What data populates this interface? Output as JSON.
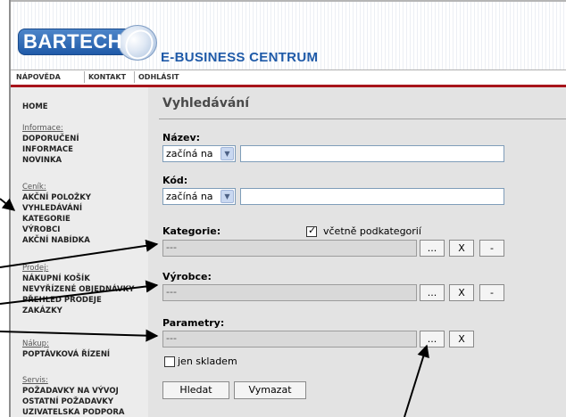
{
  "header": {
    "logo_text": "BARTECH",
    "title": "E-BUSINESS CENTRUM"
  },
  "topnav": {
    "items": [
      "NÁPOVĚDA",
      "KONTAKT",
      "ODHLÁSIT"
    ]
  },
  "sidebar": {
    "home": "HOME",
    "sections": [
      {
        "heading": "Informace:",
        "items": [
          "DOPORUČENÍ",
          "INFORMACE",
          "NOVINKA"
        ]
      },
      {
        "heading": "Ceník:",
        "items": [
          "AKČNÍ POLOŽKY",
          "VYHLEDÁVÁNÍ",
          "KATEGORIE",
          "VÝROBCI",
          "AKČNÍ NABÍDKA"
        ]
      },
      {
        "heading": "Prodej:",
        "items": [
          "NÁKUPNÍ KOŠÍK",
          "NEVYŘÍZENÉ OBJEDNÁVKY",
          "PŘEHLED PRODEJE",
          "ZAKÁZKY"
        ]
      },
      {
        "heading": "Nákup:",
        "items": [
          "POPTÁVKOVÁ ŘÍZENÍ"
        ]
      },
      {
        "heading": "Servis:",
        "items": [
          "POŽADAVKY NA VÝVOJ",
          "OSTATNÍ POŽADAVKY",
          "UŽIVATELSKÁ PODPORA"
        ]
      }
    ]
  },
  "main": {
    "title": "Vyhledávání",
    "nazev": {
      "label": "Název:",
      "mode": "začíná na",
      "value": ""
    },
    "kod": {
      "label": "Kód:",
      "mode": "začíná na",
      "value": ""
    },
    "kategorie": {
      "label": "Kategorie:",
      "value": "---",
      "include_sub_label": "včetně podkategorií",
      "include_sub_checked": true
    },
    "vyrobce": {
      "label": "Výrobce:",
      "value": "---"
    },
    "parametry": {
      "label": "Parametry:",
      "value": "---"
    },
    "ellipsis_label": "...",
    "clear_label": "X",
    "remove_label": "-",
    "in_stock_label": "jen skladem",
    "in_stock_checked": false,
    "search_button": "Hledat",
    "reset_button": "Vymazat"
  },
  "colors": {
    "brand_blue": "#1f5aa8",
    "nav_red": "#a8141b",
    "content_bg": "#e3e3e3",
    "sidebar_bg": "#ececec"
  }
}
